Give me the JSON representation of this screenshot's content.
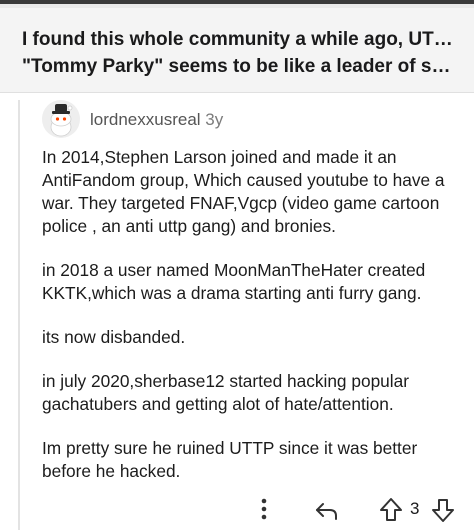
{
  "post": {
    "title_line1": "I found this whole community a while ago, UTTP, this",
    "title_line2": "\"Tommy Parky\" seems to be like a leader of sorts, af..."
  },
  "comment": {
    "username": "lordnexxusreal",
    "age": "3y",
    "paragraphs": [
      "In 2014,Stephen Larson joined and made it an AntiFandom group, Which caused youtube to have a war. They targeted FNAF,Vgcp (video game cartoon police , an anti uttp gang) and bronies.",
      "in 2018 a user named MoonManTheHater created KKTK,which was a drama starting anti furry gang.",
      "its now disbanded.",
      "in july 2020,sherbase12 started hacking popular gachatubers and getting alot of hate/attention.",
      "Im pretty sure he ruined UTTP since it was better before he hacked."
    ],
    "vote_count": "3"
  },
  "icons": {
    "avatar": "snoo-avatar-icon",
    "more": "more-vertical-icon",
    "reply": "reply-arrow-icon",
    "upvote": "upvote-arrow-icon",
    "downvote": "downvote-arrow-icon"
  },
  "colors": {
    "header_bg": "#f4f4f4",
    "text": "#1a1a1b",
    "meta": "#555555"
  }
}
